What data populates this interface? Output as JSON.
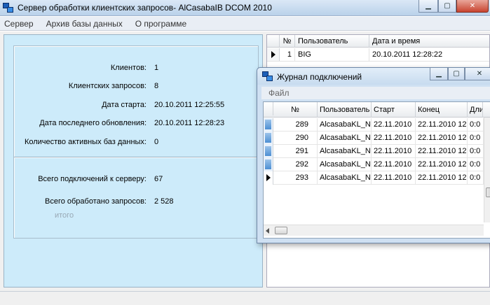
{
  "window": {
    "title": "Сервер обработки клиентских запросов- AlCasabaIB DCOM 2010",
    "controls": {
      "minimize": "▁",
      "maximize": "▢",
      "close": "✕"
    }
  },
  "menu": {
    "items": [
      "Сервер",
      "Архив базы данных",
      "О программе"
    ]
  },
  "info": {
    "clients_label": "Клиентов:",
    "clients_value": "1",
    "requests_label": "Клиентских запросов:",
    "requests_value": "8",
    "start_label": "Дата старта:",
    "start_value": "20.10.2011 12:25:55",
    "last_update_label": "Дата последнего обновления:",
    "last_update_value": "20.10.2011 12:28:23",
    "active_db_label": "Количество  активных баз данных:",
    "active_db_value": "0",
    "total_connections_label": "Всего подключений к серверу:",
    "total_connections_value": "67",
    "total_requests_label": "Всего обработано запросов:",
    "total_requests_value": "2 528",
    "caption": "итого"
  },
  "clients_grid": {
    "columns": [
      "№",
      "Пользователь",
      "Дата и время"
    ],
    "rows": [
      {
        "num": "1",
        "user": "BIG",
        "datetime": "20.10.2011 12:28:22"
      }
    ]
  },
  "journal": {
    "title": "Журнал подключений",
    "menu": [
      "Файл"
    ],
    "columns": [
      "№",
      "Пользователь",
      "Старт",
      "Конец",
      "Дли"
    ],
    "rows": [
      {
        "num": "289",
        "user": "AlcasabaKL_NEW",
        "start": "22.11.2010",
        "end": "22.11.2010 12",
        "dur": "0:0"
      },
      {
        "num": "290",
        "user": "AlcasabaKL_NEW",
        "start": "22.11.2010",
        "end": "22.11.2010 12",
        "dur": "0:0"
      },
      {
        "num": "291",
        "user": "AlcasabaKL_NEW",
        "start": "22.11.2010",
        "end": "22.11.2010 12",
        "dur": "0:0"
      },
      {
        "num": "292",
        "user": "AlcasabaKL_NEW",
        "start": "22.11.2010",
        "end": "22.11.2010 12",
        "dur": "0:0"
      },
      {
        "num": "293",
        "user": "AlcasabaKL_NEW",
        "start": "22.11.2010",
        "end": "22.11.2010 12",
        "dur": "0:0"
      }
    ]
  },
  "colors": {
    "info_panel": "#cdebfa",
    "title_bar": "#c7dbef",
    "close_button": "#c8442f"
  }
}
